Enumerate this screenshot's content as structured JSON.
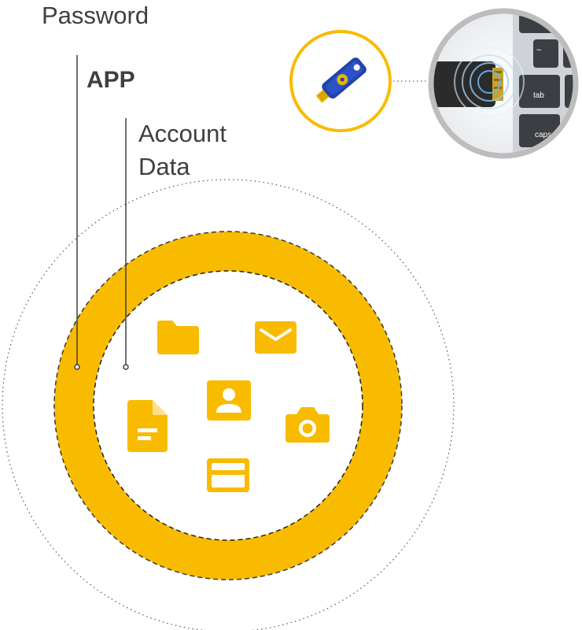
{
  "labels": {
    "password": "Password",
    "app": "APP",
    "account_line1": "Account",
    "account_line2": "Data"
  },
  "keyboard": {
    "key_tilde": "~",
    "key_tab": "tab",
    "key_caps": "caps"
  },
  "colors": {
    "accent": "#F9BB00",
    "text": "#3c4043",
    "key_blue": "#2343a8",
    "key_gold": "#e8b400",
    "frame_grey": "#bdbdbd"
  },
  "icons": [
    "folder-icon",
    "mail-icon",
    "contact-icon",
    "document-icon",
    "camera-icon",
    "credit-card-icon",
    "security-key-icon"
  ]
}
